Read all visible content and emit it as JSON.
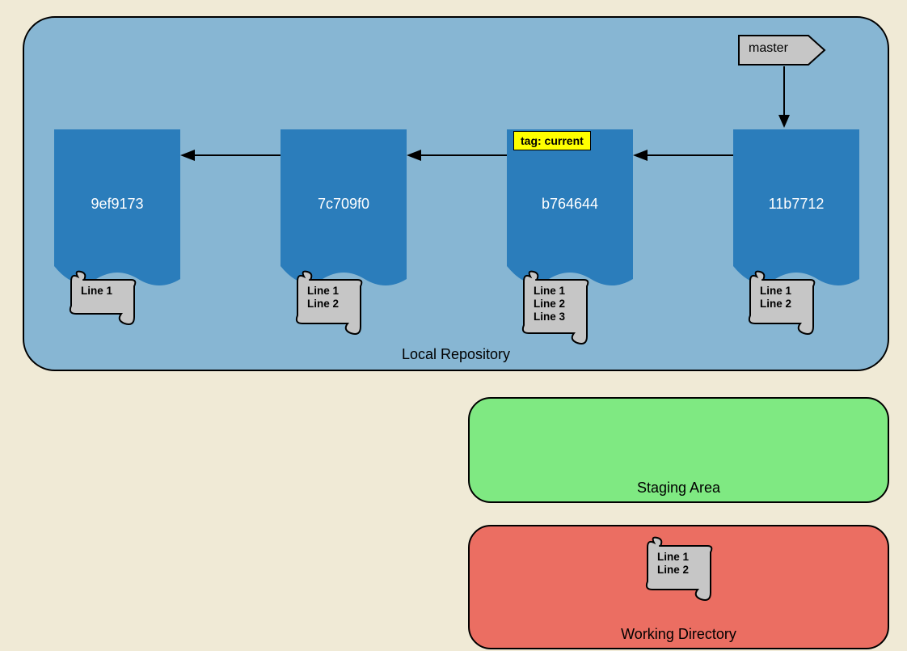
{
  "repo_label": "Local Repository",
  "staging_label": "Staging Area",
  "working_label": "Working Directory",
  "master_label": "master",
  "tag_label": "tag: current",
  "commits": [
    {
      "hash": "9ef9173",
      "scroll": "Line 1"
    },
    {
      "hash": "7c709f0",
      "scroll": "Line 1\nLine 2"
    },
    {
      "hash": "b764644",
      "scroll": "Line 1\nLine 2\nLine 3"
    },
    {
      "hash": "11b7712",
      "scroll": "Line 1\nLine 2"
    }
  ],
  "working_scroll": "Line 1\nLine 2"
}
